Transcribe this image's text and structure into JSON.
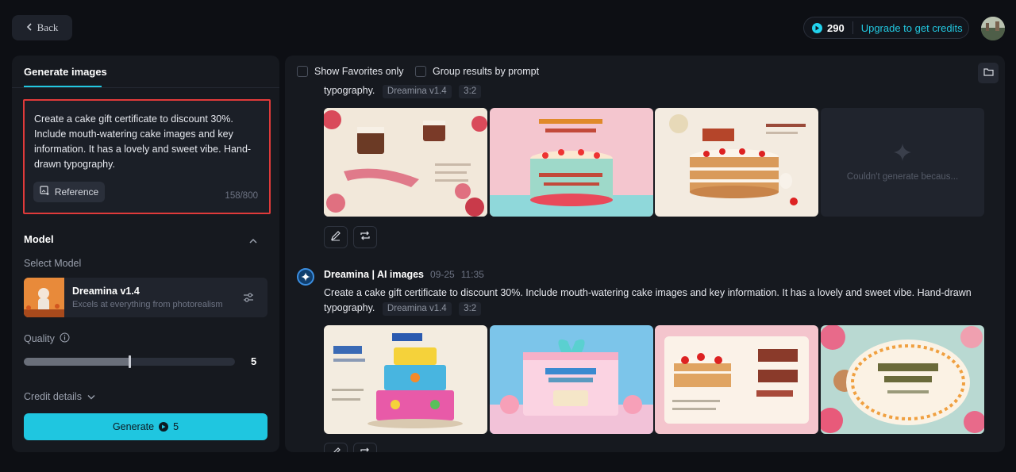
{
  "topbar": {
    "back_label": "Back",
    "credits": "290",
    "upgrade_label": "Upgrade to get credits"
  },
  "left": {
    "tab": "Generate images",
    "prompt": "Create a cake gift certificate to discount 30%. Include mouth-watering cake images and key information. It has a lovely and sweet vibe. Hand-drawn typography.",
    "reference_label": "Reference",
    "char_count": "158/800",
    "model_section": "Model",
    "select_model_label": "Select Model",
    "model_name": "Dreamina v1.4",
    "model_desc": "Excels at everything from photorealism",
    "quality_label": "Quality",
    "quality_value": "5",
    "quality_fraction": 0.5,
    "credit_details_label": "Credit details",
    "generate_label": "Generate",
    "generate_cost": "5"
  },
  "right": {
    "show_favorites": "Show Favorites only",
    "group_results": "Group results by prompt",
    "group1": {
      "prompt_tail": "typography.",
      "model_tag": "Dreamina v1.4",
      "ratio_tag": "3:2",
      "fail_text": "Couldn't generate becaus..."
    },
    "group2": {
      "sender": "Dreamina | AI images",
      "date": "09-25",
      "time": "11:35",
      "prompt_line1": "Create a cake gift certificate to discount 30%. Include mouth-watering cake images and key information. It has a lovely and sweet vibe. Hand-drawn",
      "prompt_line2": "typography.",
      "model_tag": "Dreamina v1.4",
      "ratio_tag": "3:2"
    }
  },
  "colors": {
    "accent": "#22c8e0",
    "highlight_border": "#e03a3a"
  }
}
